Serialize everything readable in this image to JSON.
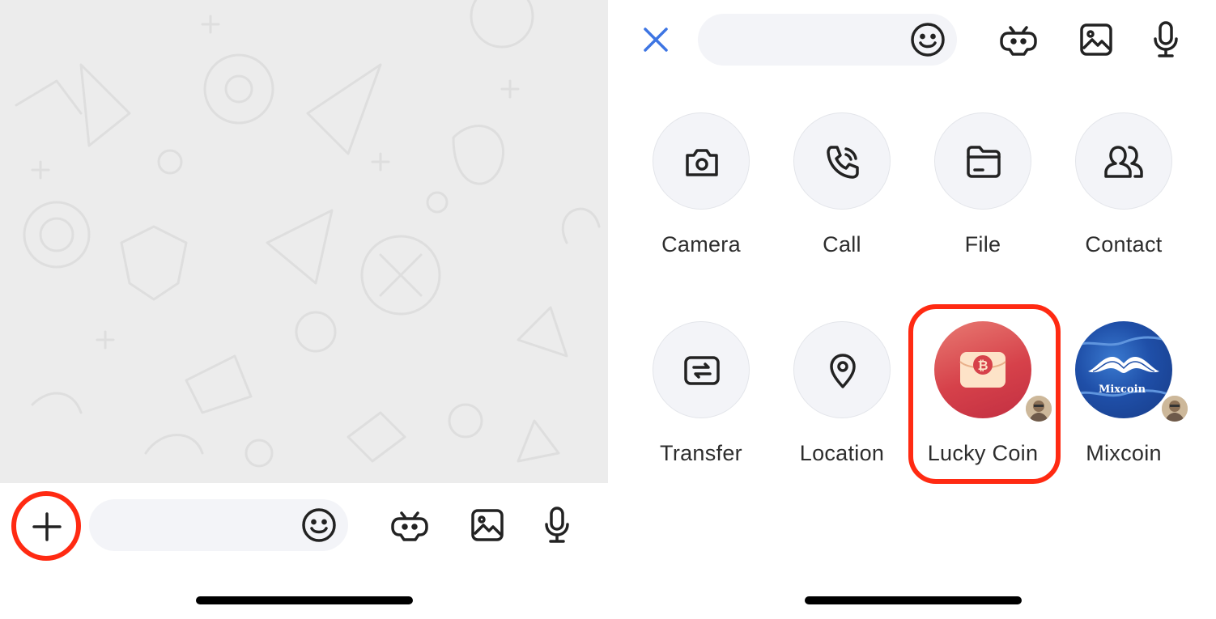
{
  "left_screen": {
    "input_bar": {
      "add_button": "plus-icon",
      "emoji_button": "emoji-icon",
      "bot_button": "bot-icon",
      "image_button": "image-icon",
      "voice_button": "microphone-icon"
    }
  },
  "right_screen": {
    "input_bar": {
      "close_button": "close-icon",
      "emoji_button": "emoji-icon",
      "bot_button": "bot-icon",
      "image_button": "image-icon",
      "voice_button": "microphone-icon"
    },
    "attachments": [
      {
        "label": "Camera",
        "icon": "camera-icon"
      },
      {
        "label": "Call",
        "icon": "phone-icon"
      },
      {
        "label": "File",
        "icon": "folder-icon"
      },
      {
        "label": "Contact",
        "icon": "contacts-icon"
      },
      {
        "label": "Transfer",
        "icon": "transfer-icon"
      },
      {
        "label": "Location",
        "icon": "location-pin-icon"
      },
      {
        "label": "Lucky Coin",
        "icon": "lucky-coin-icon"
      },
      {
        "label": "Mixcoin",
        "icon": "mixcoin-logo"
      }
    ],
    "mixcoin_logo_text": "Mixcoin"
  },
  "colors": {
    "accent_blue": "#3d75e3",
    "highlight_red": "#ff2a12",
    "lucky_coin_red": "#d9434a",
    "pill_background": "#f3f4f8",
    "wallpaper": "#ececec"
  }
}
